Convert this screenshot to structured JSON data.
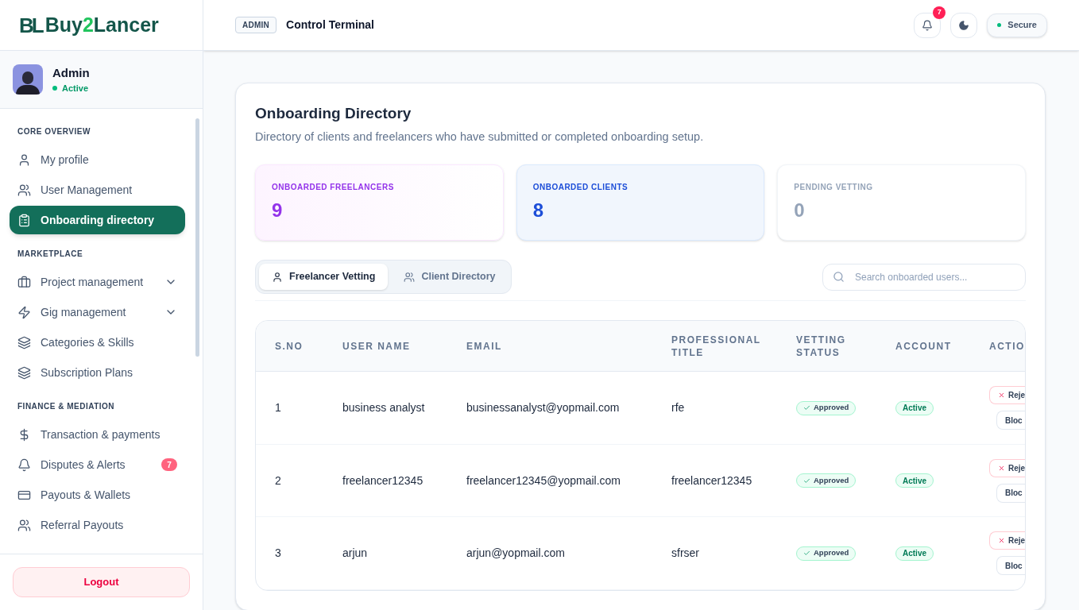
{
  "brand": {
    "mark": "BL",
    "prefix": "Buy",
    "digit": "2",
    "suffix": "Lancer"
  },
  "user": {
    "name": "Admin",
    "status": "Active"
  },
  "sidebar": {
    "sections": [
      {
        "title": "CORE OVERVIEW",
        "items": [
          {
            "label": "My profile",
            "selected": false
          },
          {
            "label": "User Management",
            "selected": false
          },
          {
            "label": "Onboarding directory",
            "selected": true
          }
        ]
      },
      {
        "title": "MARKETPLACE",
        "items": [
          {
            "label": "Project management",
            "selected": false,
            "expandable": true
          },
          {
            "label": "Gig management",
            "selected": false,
            "expandable": true
          },
          {
            "label": "Categories & Skills",
            "selected": false
          },
          {
            "label": "Subscription Plans",
            "selected": false
          }
        ]
      },
      {
        "title": "FINANCE & MEDIATION",
        "items": [
          {
            "label": "Transaction & payments",
            "selected": false
          },
          {
            "label": "Disputes & Alerts",
            "selected": false,
            "badge": "7"
          },
          {
            "label": "Payouts & Wallets",
            "selected": false
          },
          {
            "label": "Referral Payouts",
            "selected": false
          }
        ]
      }
    ],
    "logout": "Logout"
  },
  "header": {
    "badge": "ADMIN",
    "title": "Control Terminal",
    "notifications": "7",
    "status": "Secure"
  },
  "page": {
    "title": "Onboarding Directory",
    "subtitle": "Directory of clients and freelancers who have submitted or completed onboarding setup."
  },
  "stats": [
    {
      "label": "ONBOARDED FREELANCERS",
      "value": "9",
      "color": "#9333ea"
    },
    {
      "label": "ONBOARDED CLIENTS",
      "value": "8",
      "color": "#1d4ed8"
    },
    {
      "label": "PENDING VETTING",
      "value": "0",
      "color": "#94a3b8"
    }
  ],
  "tabs": [
    {
      "label": "Freelancer Vetting",
      "selected": true
    },
    {
      "label": "Client Directory",
      "selected": false
    }
  ],
  "search": {
    "placeholder": "Search onboarded users..."
  },
  "table": {
    "columns": [
      "S.NO",
      "USER NAME",
      "EMAIL",
      "PROFESSIONAL TITLE",
      "VETTING STATUS",
      "ACCOUNT",
      "ACTIO"
    ],
    "rows": [
      {
        "sno": "1",
        "name": "business analyst",
        "email": "businessanalyst@yopmail.com",
        "title": "rfe",
        "vetting": "Approved",
        "account": "Active",
        "reject": "Reje",
        "block": "Bloc"
      },
      {
        "sno": "2",
        "name": "freelancer12345",
        "email": "freelancer12345@yopmail.com",
        "title": "freelancer12345",
        "vetting": "Approved",
        "account": "Active",
        "reject": "Reje",
        "block": "Bloc"
      },
      {
        "sno": "3",
        "name": "arjun",
        "email": "arjun@yopmail.com",
        "title": "sfrser",
        "vetting": "Approved",
        "account": "Active",
        "reject": "Reje",
        "block": "Bloc"
      }
    ]
  }
}
